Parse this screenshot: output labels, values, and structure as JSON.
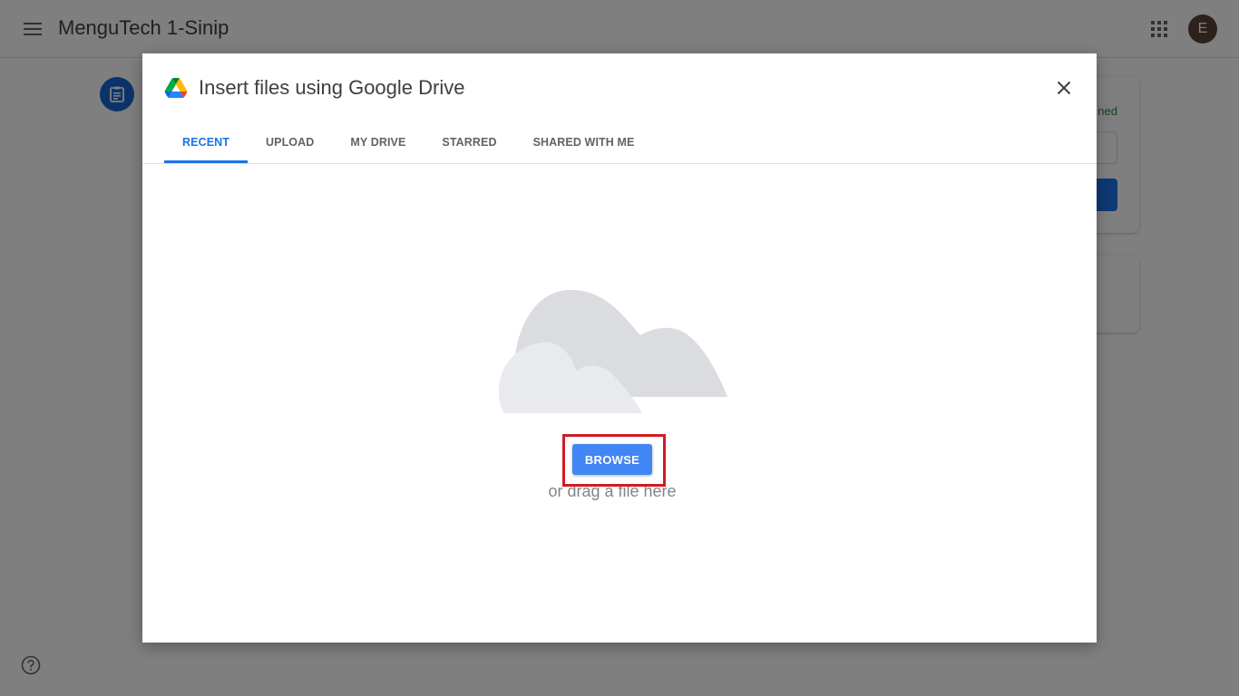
{
  "app": {
    "title": "MenguTech 1-Sinip",
    "avatar_initial": "E"
  },
  "side_card": {
    "status_fragment": "ned"
  },
  "dialog": {
    "title": "Insert files using Google Drive",
    "tabs": [
      {
        "label": "RECENT",
        "active": true
      },
      {
        "label": "UPLOAD",
        "active": false
      },
      {
        "label": "MY DRIVE",
        "active": false
      },
      {
        "label": "STARRED",
        "active": false
      },
      {
        "label": "SHARED WITH ME",
        "active": false
      }
    ],
    "browse_label": "BROWSE",
    "drag_text": "or drag a file here"
  },
  "icons": {
    "menu": "menu-icon",
    "apps": "apps-grid-icon",
    "assignment": "assignment-icon",
    "drive_logo": "google-drive-logo",
    "close": "close-icon",
    "cloud": "cloud-illustration",
    "help": "help-icon"
  },
  "colors": {
    "accent": "#1a73e8",
    "browse_button": "#4285f4",
    "highlight_box": "#d01b24",
    "avatar": "#5d4037"
  }
}
